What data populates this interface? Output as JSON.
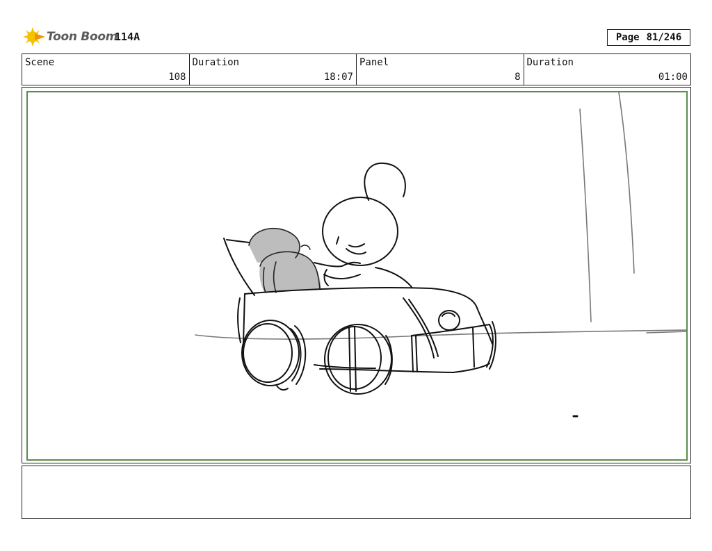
{
  "header": {
    "logo": {
      "icon": "toon-boom-sun-icon",
      "text": "Toon Boom",
      "accent_color": "#f5c200"
    },
    "episode": "114A",
    "page": {
      "label": "Page",
      "value": "81/246"
    }
  },
  "info": {
    "scene": {
      "label": "Scene",
      "value": "108"
    },
    "scene_duration": {
      "label": "Duration",
      "value": "18:07"
    },
    "panel": {
      "label": "Panel",
      "value": "8"
    },
    "panel_duration": {
      "label": "Duration",
      "value": "01:00"
    }
  },
  "panel": {
    "frame_color": "#5c8c4c",
    "image": "rough-sketch-character-driving-toy-car"
  },
  "notes": {
    "text": ""
  }
}
